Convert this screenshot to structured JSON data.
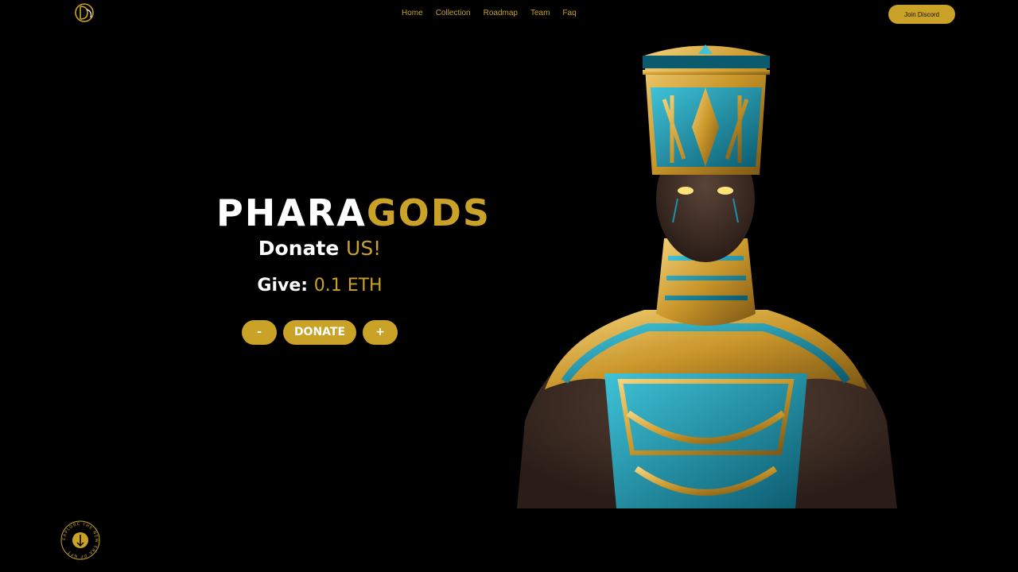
{
  "nav": {
    "items": [
      "Home",
      "Collection",
      "Roadmap",
      "Team",
      "Faq"
    ],
    "join_label": "Join Discord"
  },
  "hero": {
    "brand_part1": "PHARA",
    "brand_part2": "GODS",
    "donate_word": "Donate",
    "donate_accent": "US!",
    "give_label": "Give:",
    "give_value": "0.1 ETH",
    "minus_label": "-",
    "donate_label": "DONATE",
    "plus_label": "+"
  },
  "badge": {
    "ring_text": "EXPLORE THE NEW ERA OF NFT"
  },
  "colors": {
    "accent": "#c9a227",
    "background": "#000000",
    "teal": "#1f8ea8"
  }
}
